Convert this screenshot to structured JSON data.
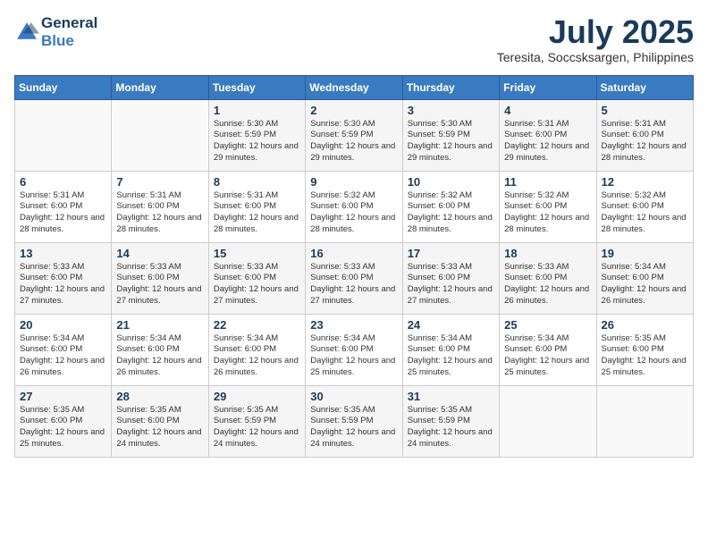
{
  "header": {
    "logo_line1": "General",
    "logo_line2": "Blue",
    "title": "July 2025",
    "subtitle": "Teresita, Soccsksargen, Philippines"
  },
  "weekdays": [
    "Sunday",
    "Monday",
    "Tuesday",
    "Wednesday",
    "Thursday",
    "Friday",
    "Saturday"
  ],
  "weeks": [
    [
      {
        "day": "",
        "sunrise": "",
        "sunset": "",
        "daylight": ""
      },
      {
        "day": "",
        "sunrise": "",
        "sunset": "",
        "daylight": ""
      },
      {
        "day": "1",
        "sunrise": "Sunrise: 5:30 AM",
        "sunset": "Sunset: 5:59 PM",
        "daylight": "Daylight: 12 hours and 29 minutes."
      },
      {
        "day": "2",
        "sunrise": "Sunrise: 5:30 AM",
        "sunset": "Sunset: 5:59 PM",
        "daylight": "Daylight: 12 hours and 29 minutes."
      },
      {
        "day": "3",
        "sunrise": "Sunrise: 5:30 AM",
        "sunset": "Sunset: 5:59 PM",
        "daylight": "Daylight: 12 hours and 29 minutes."
      },
      {
        "day": "4",
        "sunrise": "Sunrise: 5:31 AM",
        "sunset": "Sunset: 6:00 PM",
        "daylight": "Daylight: 12 hours and 29 minutes."
      },
      {
        "day": "5",
        "sunrise": "Sunrise: 5:31 AM",
        "sunset": "Sunset: 6:00 PM",
        "daylight": "Daylight: 12 hours and 28 minutes."
      }
    ],
    [
      {
        "day": "6",
        "sunrise": "Sunrise: 5:31 AM",
        "sunset": "Sunset: 6:00 PM",
        "daylight": "Daylight: 12 hours and 28 minutes."
      },
      {
        "day": "7",
        "sunrise": "Sunrise: 5:31 AM",
        "sunset": "Sunset: 6:00 PM",
        "daylight": "Daylight: 12 hours and 28 minutes."
      },
      {
        "day": "8",
        "sunrise": "Sunrise: 5:31 AM",
        "sunset": "Sunset: 6:00 PM",
        "daylight": "Daylight: 12 hours and 28 minutes."
      },
      {
        "day": "9",
        "sunrise": "Sunrise: 5:32 AM",
        "sunset": "Sunset: 6:00 PM",
        "daylight": "Daylight: 12 hours and 28 minutes."
      },
      {
        "day": "10",
        "sunrise": "Sunrise: 5:32 AM",
        "sunset": "Sunset: 6:00 PM",
        "daylight": "Daylight: 12 hours and 28 minutes."
      },
      {
        "day": "11",
        "sunrise": "Sunrise: 5:32 AM",
        "sunset": "Sunset: 6:00 PM",
        "daylight": "Daylight: 12 hours and 28 minutes."
      },
      {
        "day": "12",
        "sunrise": "Sunrise: 5:32 AM",
        "sunset": "Sunset: 6:00 PM",
        "daylight": "Daylight: 12 hours and 28 minutes."
      }
    ],
    [
      {
        "day": "13",
        "sunrise": "Sunrise: 5:33 AM",
        "sunset": "Sunset: 6:00 PM",
        "daylight": "Daylight: 12 hours and 27 minutes."
      },
      {
        "day": "14",
        "sunrise": "Sunrise: 5:33 AM",
        "sunset": "Sunset: 6:00 PM",
        "daylight": "Daylight: 12 hours and 27 minutes."
      },
      {
        "day": "15",
        "sunrise": "Sunrise: 5:33 AM",
        "sunset": "Sunset: 6:00 PM",
        "daylight": "Daylight: 12 hours and 27 minutes."
      },
      {
        "day": "16",
        "sunrise": "Sunrise: 5:33 AM",
        "sunset": "Sunset: 6:00 PM",
        "daylight": "Daylight: 12 hours and 27 minutes."
      },
      {
        "day": "17",
        "sunrise": "Sunrise: 5:33 AM",
        "sunset": "Sunset: 6:00 PM",
        "daylight": "Daylight: 12 hours and 27 minutes."
      },
      {
        "day": "18",
        "sunrise": "Sunrise: 5:33 AM",
        "sunset": "Sunset: 6:00 PM",
        "daylight": "Daylight: 12 hours and 26 minutes."
      },
      {
        "day": "19",
        "sunrise": "Sunrise: 5:34 AM",
        "sunset": "Sunset: 6:00 PM",
        "daylight": "Daylight: 12 hours and 26 minutes."
      }
    ],
    [
      {
        "day": "20",
        "sunrise": "Sunrise: 5:34 AM",
        "sunset": "Sunset: 6:00 PM",
        "daylight": "Daylight: 12 hours and 26 minutes."
      },
      {
        "day": "21",
        "sunrise": "Sunrise: 5:34 AM",
        "sunset": "Sunset: 6:00 PM",
        "daylight": "Daylight: 12 hours and 26 minutes."
      },
      {
        "day": "22",
        "sunrise": "Sunrise: 5:34 AM",
        "sunset": "Sunset: 6:00 PM",
        "daylight": "Daylight: 12 hours and 26 minutes."
      },
      {
        "day": "23",
        "sunrise": "Sunrise: 5:34 AM",
        "sunset": "Sunset: 6:00 PM",
        "daylight": "Daylight: 12 hours and 25 minutes."
      },
      {
        "day": "24",
        "sunrise": "Sunrise: 5:34 AM",
        "sunset": "Sunset: 6:00 PM",
        "daylight": "Daylight: 12 hours and 25 minutes."
      },
      {
        "day": "25",
        "sunrise": "Sunrise: 5:34 AM",
        "sunset": "Sunset: 6:00 PM",
        "daylight": "Daylight: 12 hours and 25 minutes."
      },
      {
        "day": "26",
        "sunrise": "Sunrise: 5:35 AM",
        "sunset": "Sunset: 6:00 PM",
        "daylight": "Daylight: 12 hours and 25 minutes."
      }
    ],
    [
      {
        "day": "27",
        "sunrise": "Sunrise: 5:35 AM",
        "sunset": "Sunset: 6:00 PM",
        "daylight": "Daylight: 12 hours and 25 minutes."
      },
      {
        "day": "28",
        "sunrise": "Sunrise: 5:35 AM",
        "sunset": "Sunset: 6:00 PM",
        "daylight": "Daylight: 12 hours and 24 minutes."
      },
      {
        "day": "29",
        "sunrise": "Sunrise: 5:35 AM",
        "sunset": "Sunset: 5:59 PM",
        "daylight": "Daylight: 12 hours and 24 minutes."
      },
      {
        "day": "30",
        "sunrise": "Sunrise: 5:35 AM",
        "sunset": "Sunset: 5:59 PM",
        "daylight": "Daylight: 12 hours and 24 minutes."
      },
      {
        "day": "31",
        "sunrise": "Sunrise: 5:35 AM",
        "sunset": "Sunset: 5:59 PM",
        "daylight": "Daylight: 12 hours and 24 minutes."
      },
      {
        "day": "",
        "sunrise": "",
        "sunset": "",
        "daylight": ""
      },
      {
        "day": "",
        "sunrise": "",
        "sunset": "",
        "daylight": ""
      }
    ]
  ]
}
